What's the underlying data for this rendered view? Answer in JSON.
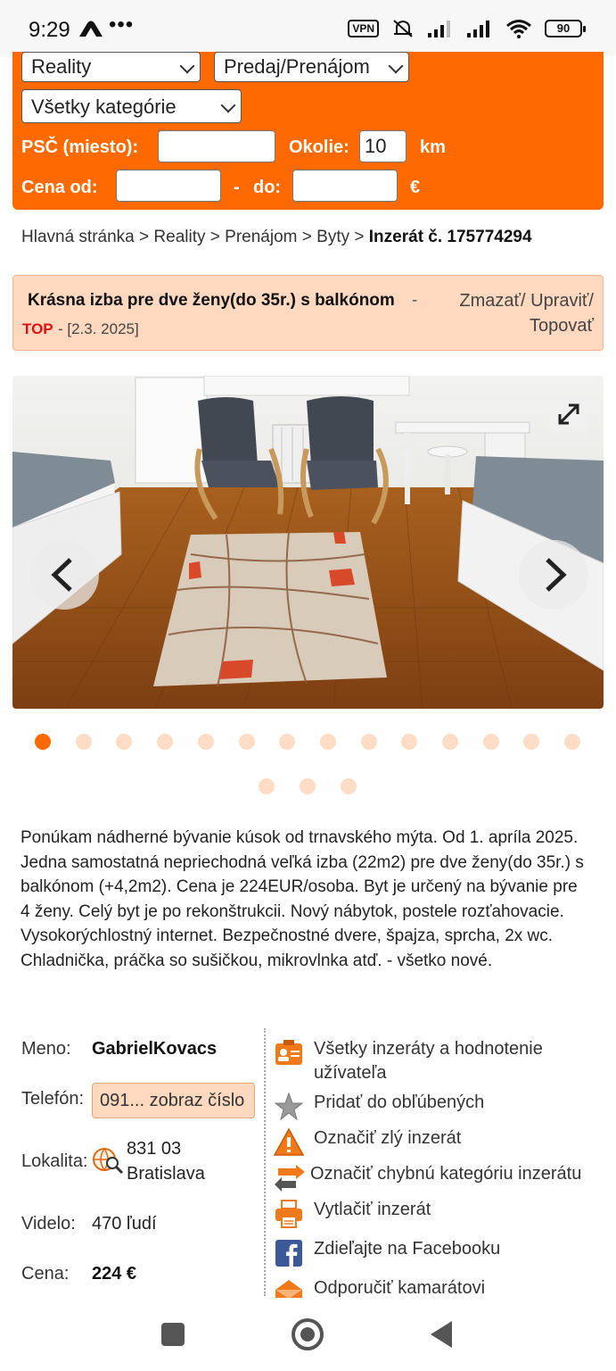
{
  "status_bar": {
    "time": "9:29",
    "dots": "•••",
    "vpn": "VPN",
    "battery": "90"
  },
  "search": {
    "category_select": "Reality",
    "type_select": "Predaj/Prenájom",
    "subcategory_select": "Všetky kategórie",
    "psc_label": "PSČ  (miesto):",
    "psc_value": "",
    "okolie_label": "Okolie:",
    "okolie_value": "10",
    "km_label": "km",
    "cena_od_label": "Cena  od:",
    "cena_from_value": "",
    "dash": "-",
    "do_label": "do:",
    "cena_to_value": "",
    "currency": "€"
  },
  "breadcrumb": {
    "items": [
      "Hlavná stránka",
      "Reality",
      "Prenájom",
      "Byty"
    ],
    "separator": ">",
    "current": "Inzerát č. 175774294"
  },
  "ad": {
    "title": "Krásna izba pre dve ženy(do 35r.) s balkónom",
    "title_separator": "-",
    "top_badge": "TOP",
    "date": "- [2.3. 2025]",
    "actions": "Zmazať/ Upraviť/ Topovať"
  },
  "gallery": {
    "total_dots": 17,
    "active_index": 0
  },
  "description": "Ponúkam nádherné bývanie kúsok od trnavského mýta. Od 1. apríla 2025. Jedna samostatná nepriechodná veľká izba (22m2) pre dve ženy(do 35r.) s balkónom (+4,2m2). Cena je 224EUR/osoba. Byt je určený na bývanie pre 4 ženy. Celý byt je po rekonštrukcii. Nový nábytok, postele rozťahovacie. Vysokorýchlostný internet. Bezpečnostné dvere, špajza, sprcha, 2x wc. Chladnička, práčka so sušičkou, mikrovlnka atď. - všetko nové.",
  "info": {
    "meno_label": "Meno:",
    "meno_value": "GabrielKovacs",
    "telefon_label": "Telefón:",
    "telefon_button": "091... zobraz číslo",
    "lokalita_label": "Lokalita:",
    "lokalita_zip": "831 03",
    "lokalita_city": "Bratislava",
    "videlo_label": "Videlo:",
    "videlo_value": "470 ľudí",
    "cena_label": "Cena:",
    "cena_value": "224 €"
  },
  "actions": [
    {
      "label": "Všetky inzeráty a hodnotenie užívateľa",
      "icon": "user-card-icon"
    },
    {
      "label": "Pridať do obľúbených",
      "icon": "star-icon"
    },
    {
      "label": "Označiť zlý inzerát",
      "icon": "warning-icon"
    },
    {
      "label": "Označiť chybnú kategóriu inzerátu",
      "icon": "swap-arrows-icon"
    },
    {
      "label": "Vytlačiť inzerát",
      "icon": "printer-icon"
    },
    {
      "label": "Zdieľajte na Facebooku",
      "icon": "facebook-icon"
    },
    {
      "label": "Odporučiť kamarátovi",
      "icon": "envelope-icon"
    }
  ],
  "colors": {
    "accent": "#ff6a00",
    "light_accent": "#ffd8c0",
    "top_red": "#e01010"
  }
}
